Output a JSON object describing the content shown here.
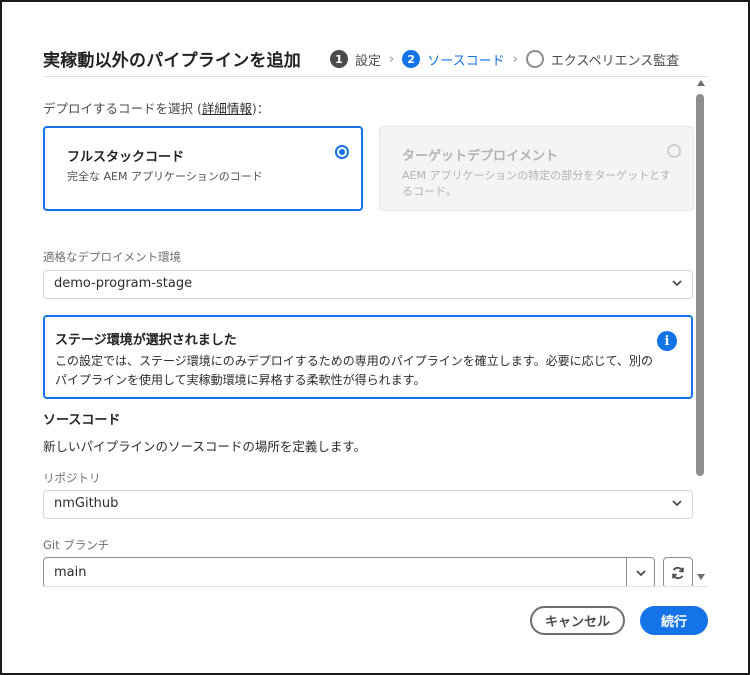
{
  "dialog": {
    "title": "実稼動以外のパイプラインを追加"
  },
  "stepper": {
    "steps": [
      {
        "number": "1",
        "label": "設定",
        "state": "done"
      },
      {
        "number": "2",
        "label": "ソースコード",
        "state": "active"
      },
      {
        "number": "",
        "label": "エクスペリエンス監査",
        "state": "todo"
      }
    ],
    "separator_icon": "chevron-right-icon"
  },
  "deploy_code": {
    "label_prefix": "デプロイするコードを選択 (",
    "link_text": "詳細情報",
    "label_suffix": ")：",
    "options": [
      {
        "title": "フルスタックコード",
        "description": "完全な AEM アプリケーションのコード",
        "selected": true,
        "disabled": false
      },
      {
        "title": "ターゲットデプロイメント",
        "description": "AEM アプリケーションの特定の部分をターゲットとするコード。",
        "selected": false,
        "disabled": true
      }
    ]
  },
  "environment": {
    "label": "適格なデプロイメント環境",
    "value": "demo-program-stage"
  },
  "info_box": {
    "title": "ステージ環境が選択されました",
    "body": "この設定では、ステージ環境にのみデプロイするための専用のパイプラインを確立します。必要に応じて、別のパイプラインを使用して実稼動環境に昇格する柔軟性が得られます。",
    "icon": "info-icon"
  },
  "source_code": {
    "heading": "ソースコード",
    "description": "新しいパイプラインのソースコードの場所を定義します。",
    "repository_label": "リポジトリ",
    "repository_value": "nmGithub",
    "branch_label": "Git ブランチ",
    "branch_value": "main",
    "refresh_icon": "refresh-icon"
  },
  "footer": {
    "cancel_label": "キャンセル",
    "continue_label": "続行"
  },
  "colors": {
    "accent": "#1473e6",
    "step_done": "#4b4b4b",
    "disabled_bg": "#f4f4f4"
  }
}
